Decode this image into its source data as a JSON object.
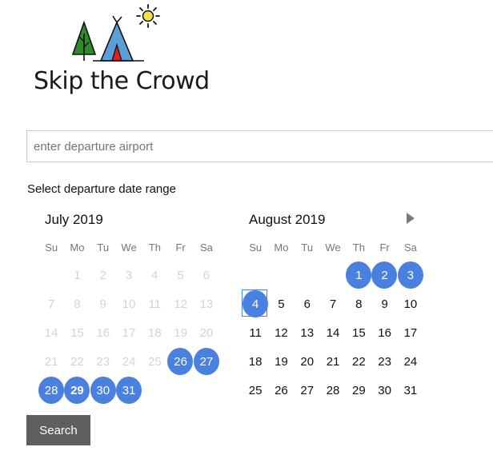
{
  "logo": {
    "text": "Skip the Crowd"
  },
  "departure": {
    "placeholder": "enter departure airport",
    "value": ""
  },
  "date_range": {
    "label": "Select departure date range"
  },
  "calendar": {
    "weekdays": [
      "Su",
      "Mo",
      "Tu",
      "We",
      "Th",
      "Fr",
      "Sa"
    ],
    "months": [
      {
        "title": "July 2019",
        "weeks": [
          [
            {
              "d": ""
            },
            {
              "d": "1",
              "s": "disabled"
            },
            {
              "d": "2",
              "s": "disabled"
            },
            {
              "d": "3",
              "s": "disabled"
            },
            {
              "d": "4",
              "s": "disabled"
            },
            {
              "d": "5",
              "s": "disabled"
            },
            {
              "d": "6",
              "s": "disabled"
            }
          ],
          [
            {
              "d": "7",
              "s": "disabled"
            },
            {
              "d": "8",
              "s": "disabled"
            },
            {
              "d": "9",
              "s": "disabled"
            },
            {
              "d": "10",
              "s": "disabled"
            },
            {
              "d": "11",
              "s": "disabled"
            },
            {
              "d": "12",
              "s": "disabled"
            },
            {
              "d": "13",
              "s": "disabled"
            }
          ],
          [
            {
              "d": "14",
              "s": "disabled"
            },
            {
              "d": "15",
              "s": "disabled"
            },
            {
              "d": "16",
              "s": "disabled"
            },
            {
              "d": "17",
              "s": "disabled"
            },
            {
              "d": "18",
              "s": "disabled"
            },
            {
              "d": "19",
              "s": "disabled"
            },
            {
              "d": "20",
              "s": "disabled"
            }
          ],
          [
            {
              "d": "21",
              "s": "disabled"
            },
            {
              "d": "22",
              "s": "disabled"
            },
            {
              "d": "23",
              "s": "disabled"
            },
            {
              "d": "24",
              "s": "disabled"
            },
            {
              "d": "25",
              "s": "disabled"
            },
            {
              "d": "26",
              "s": "sel"
            },
            {
              "d": "27",
              "s": "sel"
            }
          ],
          [
            {
              "d": "28",
              "s": "sel"
            },
            {
              "d": "29",
              "s": "sel today"
            },
            {
              "d": "30",
              "s": "sel"
            },
            {
              "d": "31",
              "s": "sel"
            },
            {
              "d": ""
            },
            {
              "d": ""
            },
            {
              "d": ""
            }
          ]
        ]
      },
      {
        "title": "August 2019",
        "weeks": [
          [
            {
              "d": ""
            },
            {
              "d": ""
            },
            {
              "d": ""
            },
            {
              "d": ""
            },
            {
              "d": "1",
              "s": "sel"
            },
            {
              "d": "2",
              "s": "sel"
            },
            {
              "d": "3",
              "s": "sel"
            }
          ],
          [
            {
              "d": "4",
              "s": "sel focus"
            },
            {
              "d": "5"
            },
            {
              "d": "6"
            },
            {
              "d": "7"
            },
            {
              "d": "8"
            },
            {
              "d": "9"
            },
            {
              "d": "10"
            }
          ],
          [
            {
              "d": "11"
            },
            {
              "d": "12"
            },
            {
              "d": "13"
            },
            {
              "d": "14"
            },
            {
              "d": "15"
            },
            {
              "d": "16"
            },
            {
              "d": "17"
            }
          ],
          [
            {
              "d": "18"
            },
            {
              "d": "19"
            },
            {
              "d": "20"
            },
            {
              "d": "21"
            },
            {
              "d": "22"
            },
            {
              "d": "23"
            },
            {
              "d": "24"
            }
          ],
          [
            {
              "d": "25"
            },
            {
              "d": "26"
            },
            {
              "d": "27"
            },
            {
              "d": "28"
            },
            {
              "d": "29"
            },
            {
              "d": "30"
            },
            {
              "d": "31"
            }
          ]
        ]
      }
    ]
  },
  "search_button": {
    "label": "Search"
  },
  "colors": {
    "selected": "#4a80e0",
    "button": "#5f5f5f",
    "disabled_text": "#d4d4d4"
  },
  "icons": {
    "next_month": "triangle-right-icon"
  }
}
